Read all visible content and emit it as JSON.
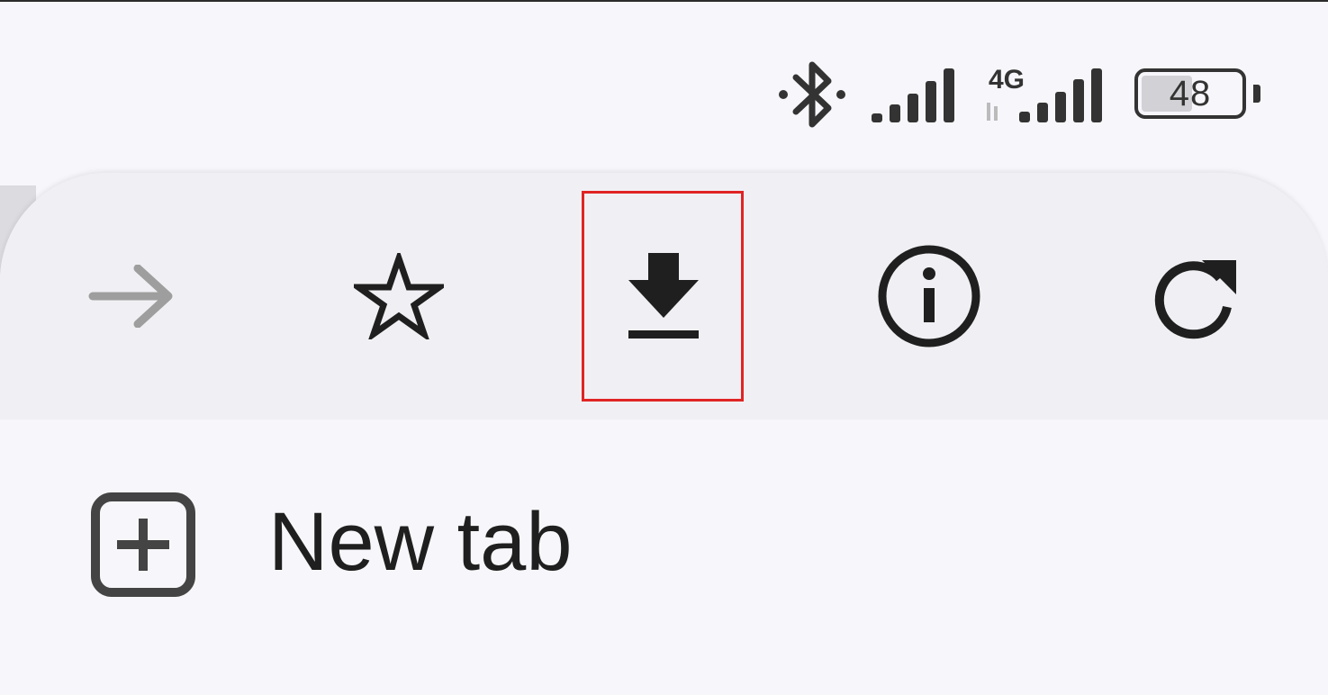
{
  "status_bar": {
    "icons": [
      "bluetooth-icon",
      "signal-icon",
      "signal-4g-icon",
      "battery-icon"
    ],
    "network_type": "4G",
    "battery_level": "48"
  },
  "toolbar": {
    "buttons": [
      {
        "name": "forward",
        "icon": "arrow-right-icon",
        "enabled": false
      },
      {
        "name": "bookmark",
        "icon": "star-outline-icon",
        "enabled": true
      },
      {
        "name": "download",
        "icon": "download-icon",
        "enabled": true,
        "highlighted": true
      },
      {
        "name": "page-info",
        "icon": "info-icon",
        "enabled": true
      },
      {
        "name": "reload",
        "icon": "reload-icon",
        "enabled": true
      }
    ],
    "highlight_color": "#e02424"
  },
  "menu": {
    "items": [
      {
        "label": "New tab",
        "icon": "add-box-icon"
      }
    ]
  },
  "colors": {
    "background": "#f7f7fb",
    "toolbar_background": "#f0f0f4",
    "icon_color": "#1f1f1f",
    "disabled_icon_color": "#9e9e9e"
  }
}
